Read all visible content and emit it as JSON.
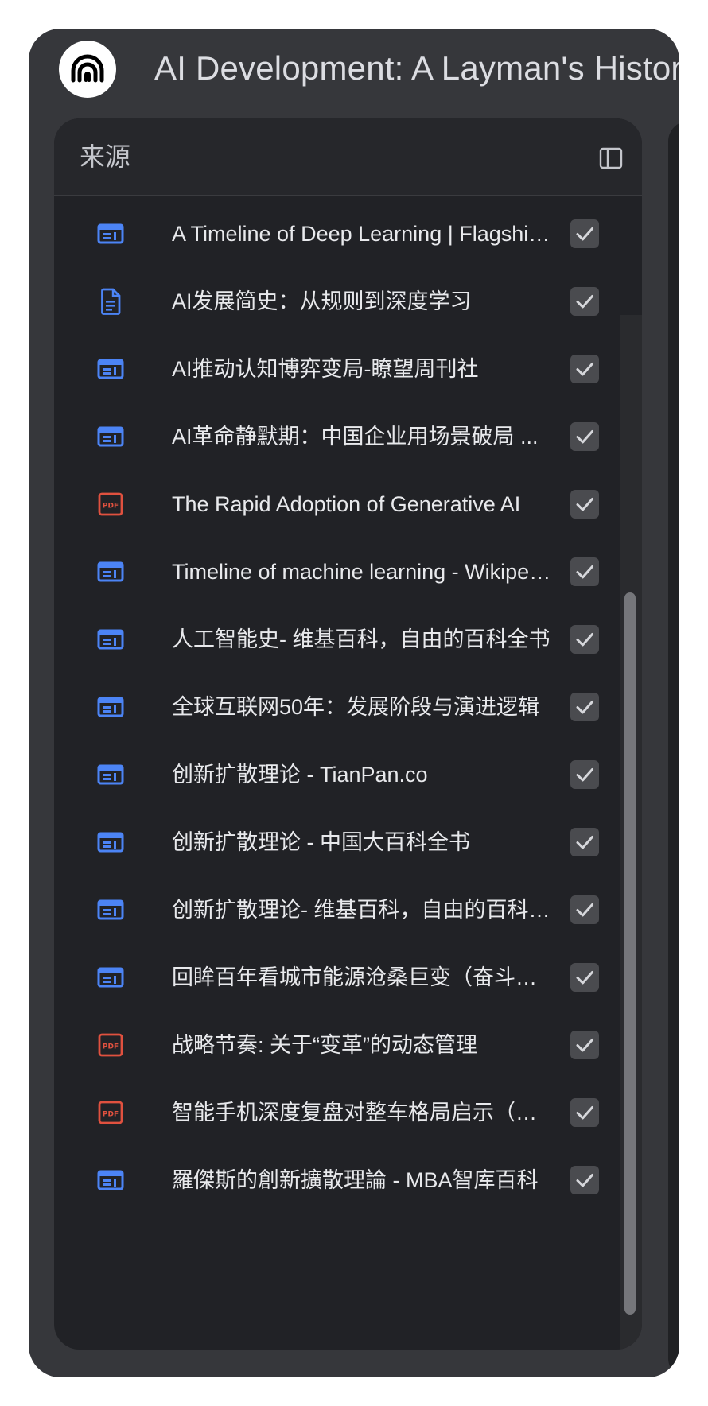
{
  "header": {
    "title": "AI Development: A Layman's History",
    "logo_icon": "notebooklm-logo-icon"
  },
  "sources_panel": {
    "title": "来源",
    "toggle_icon": "panel-toggle-icon",
    "items": [
      {
        "label": "A Timeline of Deep Learning | Flagship Pioneering",
        "icon": "web-page-icon",
        "checked": true
      },
      {
        "label": "AI发展简史：从规则到深度学习",
        "icon": "document-icon",
        "checked": true
      },
      {
        "label": "AI推动认知博弈变局-瞭望周刊社",
        "icon": "web-page-icon",
        "checked": true
      },
      {
        "label": "AI革命静默期：中国企业用场景破局 ...",
        "icon": "web-page-icon",
        "checked": true
      },
      {
        "label": "The Rapid Adoption of Generative AI",
        "icon": "pdf-icon",
        "checked": true
      },
      {
        "label": "Timeline of machine learning - Wikipedia",
        "icon": "web-page-icon",
        "checked": true
      },
      {
        "label": "人工智能史- 维基百科，自由的百科全书",
        "icon": "web-page-icon",
        "checked": true
      },
      {
        "label": "全球互联网50年：发展阶段与演进逻辑",
        "icon": "web-page-icon",
        "checked": true
      },
      {
        "label": "创新扩散理论 - TianPan.co",
        "icon": "web-page-icon",
        "checked": true
      },
      {
        "label": "创新扩散理论 - 中国大百科全书",
        "icon": "web-page-icon",
        "checked": true
      },
      {
        "label": "创新扩散理论- 维基百科，自由的百科全书",
        "icon": "web-page-icon",
        "checked": true
      },
      {
        "label": "回眸百年看城市能源沧桑巨变（奋斗百年路）",
        "icon": "web-page-icon",
        "checked": true
      },
      {
        "label": "战略节奏: 关于“变革”的动态管理",
        "icon": "pdf-icon",
        "checked": true
      },
      {
        "label": "智能手机深度复盘对整车格局启示（汽车）",
        "icon": "pdf-icon",
        "checked": true
      },
      {
        "label": "羅傑斯的創新擴散理論 - MBA智库百科",
        "icon": "web-page-icon",
        "checked": true
      }
    ]
  },
  "colors": {
    "background": "#36373b",
    "panel": "#212226",
    "web_icon": "#4c84f5",
    "pdf_icon": "#e0513f",
    "text": "#e8e9ec"
  }
}
